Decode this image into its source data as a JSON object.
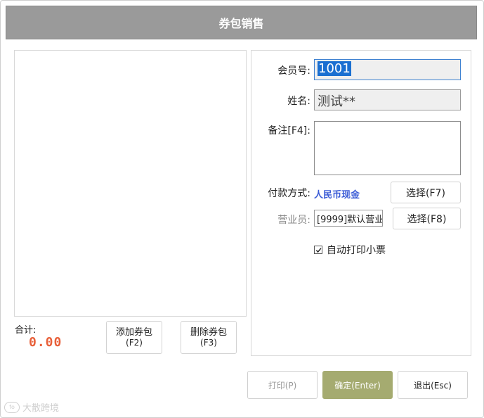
{
  "window": {
    "title": "券包销售"
  },
  "summary": {
    "total_label": "合计:",
    "total_value": "0.00"
  },
  "buttons": {
    "add": {
      "line1": "添加券包",
      "line2": "(F2)"
    },
    "delete": {
      "line1": "删除券包",
      "line2": "(F3)"
    },
    "pay_select": "选择(F7)",
    "sales_select": "选择(F8)",
    "print": "打印(P)",
    "confirm": "确定(Enter)",
    "exit": "退出(Esc)"
  },
  "form": {
    "member_label": "会员号:",
    "member_value": "1001",
    "name_label": "姓名:",
    "name_value": "测试**",
    "remark_label": "备注[F4]:",
    "remark_value": "",
    "payment_label": "付款方式:",
    "payment_value": "人民币现金",
    "salesperson_label": "营业员:",
    "salesperson_value": "[9999]默认营业",
    "auto_print_label": "自动打印小票",
    "auto_print_checked": true
  },
  "watermark": {
    "logo": "fo",
    "text": "大散跨境"
  },
  "colors": {
    "title_bar": "#9a9a9a",
    "total_value": "#e8603a",
    "payment_value": "#3a5bd6",
    "confirm_button": "#a5ab70"
  }
}
